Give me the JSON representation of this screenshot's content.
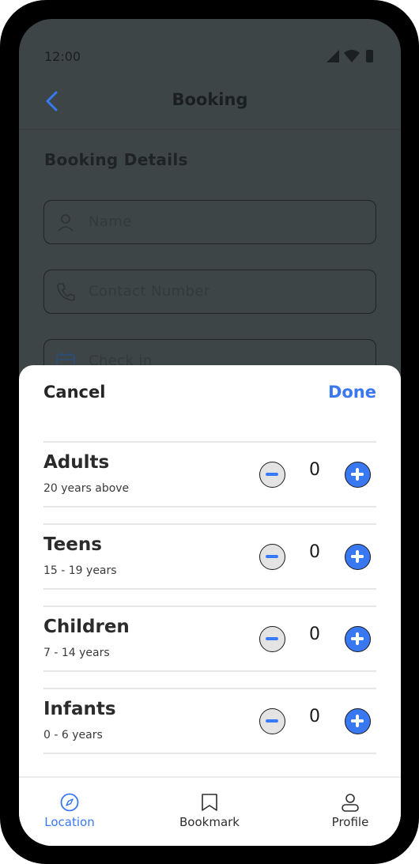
{
  "status_bar": {
    "time": "12:00",
    "icons": [
      "signal-icon",
      "wifi-icon",
      "battery-icon"
    ]
  },
  "header": {
    "title": "Booking",
    "back_icon": "chevron-left-icon"
  },
  "form": {
    "section_title": "Booking Details",
    "fields": [
      {
        "placeholder": "Name",
        "icon": "user-icon"
      },
      {
        "placeholder": "Contact Number",
        "icon": "phone-icon"
      },
      {
        "placeholder": "Check in",
        "icon": "calendar-icon"
      }
    ]
  },
  "sheet": {
    "cancel_label": "Cancel",
    "done_label": "Done",
    "guests": [
      {
        "title": "Adults",
        "subtitle": "20 years above",
        "count": "0"
      },
      {
        "title": "Teens",
        "subtitle": "15 - 19 years",
        "count": "0"
      },
      {
        "title": "Children",
        "subtitle": "7 - 14 years",
        "count": "0"
      },
      {
        "title": "Infants",
        "subtitle": "0 - 6 years",
        "count": "0"
      }
    ]
  },
  "bottom_nav": {
    "items": [
      {
        "label": "Location",
        "icon": "compass-icon",
        "active": true
      },
      {
        "label": "Bookmark",
        "icon": "bookmark-icon",
        "active": false
      },
      {
        "label": "Profile",
        "icon": "profile-icon",
        "active": false
      }
    ]
  },
  "colors": {
    "accent": "#3a78f2",
    "overlay": "#3e4546",
    "frame": "#000000",
    "sheet": "#ffffff"
  }
}
